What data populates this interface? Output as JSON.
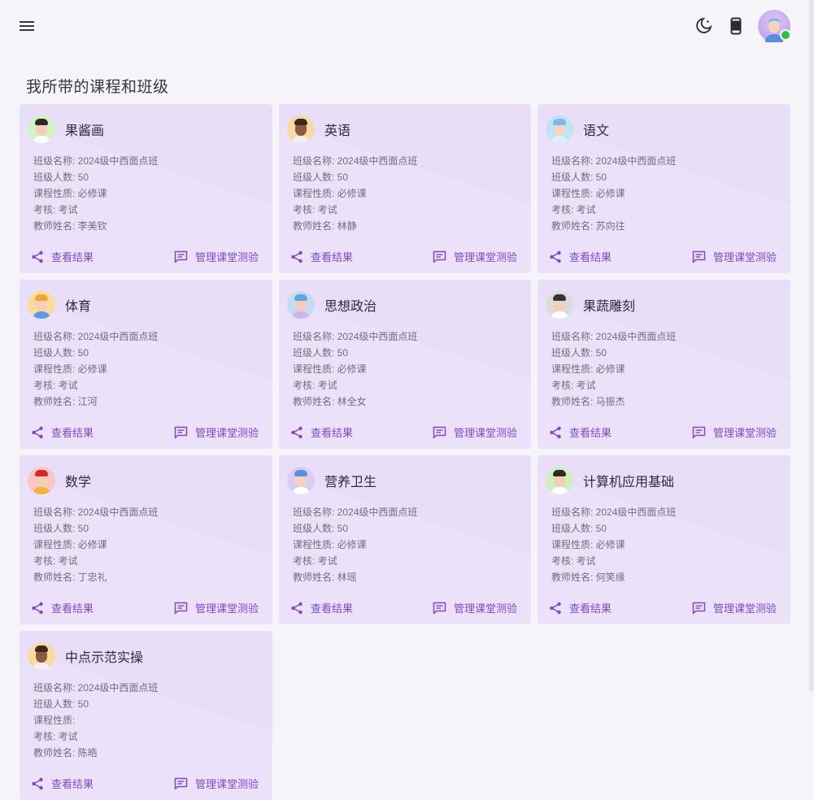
{
  "page": {
    "title": "我所带的课程和班级"
  },
  "labels": {
    "class_name": "班级名称: ",
    "student_count": "班级人数: ",
    "course_type": "课程性质: ",
    "assessment": "考核: ",
    "teacher": "教师姓名: ",
    "view_results": "查看结果",
    "manage_quiz": "管理课堂测验"
  },
  "courses": [
    {
      "title": "果酱画",
      "class_name": "2024级中西面点班",
      "student_count": "50",
      "course_type": "必修课",
      "assessment": "考试",
      "teacher": "李美钦",
      "avatar_bg": "#d3f2c4",
      "hair": "#2d2824",
      "skin": "#f4cdb7",
      "shirt": "#ffffff"
    },
    {
      "title": "英语",
      "class_name": "2024级中西面点班",
      "student_count": "50",
      "course_type": "必修课",
      "assessment": "考试",
      "teacher": "林静",
      "avatar_bg": "#f8d9a4",
      "hair": "#3a2b22",
      "skin": "#8b5a3c",
      "shirt": "#f0f0f0"
    },
    {
      "title": "语文",
      "class_name": "2024级中西面点班",
      "student_count": "50",
      "course_type": "必修课",
      "assessment": "考试",
      "teacher": "苏向往",
      "avatar_bg": "#bfe2f6",
      "hair": "#7fb6e8",
      "skin": "#f6d4c2",
      "shirt": "#dfeffa"
    },
    {
      "title": "体育",
      "class_name": "2024级中西面点班",
      "student_count": "50",
      "course_type": "必修课",
      "assessment": "考试",
      "teacher": "江河",
      "avatar_bg": "#f9dca0",
      "hair": "#f5a537",
      "skin": "#f7cfb2",
      "shirt": "#5f98e8"
    },
    {
      "title": "思想政治",
      "class_name": "2024级中西面点班",
      "student_count": "50",
      "course_type": "必修课",
      "assessment": "考试",
      "teacher": "林全女",
      "avatar_bg": "#c3dcf3",
      "hair": "#5ba7e3",
      "skin": "#f3cdbb",
      "shirt": "#cfb4ef"
    },
    {
      "title": "果蔬雕刻",
      "class_name": "2024级中西面点班",
      "student_count": "50",
      "course_type": "必修课",
      "assessment": "考试",
      "teacher": "马振杰",
      "avatar_bg": "#dcdcdc",
      "hair": "#3b3330",
      "skin": "#f3d0c0",
      "shirt": "#ffffff"
    },
    {
      "title": "数学",
      "class_name": "2024级中西面点班",
      "student_count": "50",
      "course_type": "必修课",
      "assessment": "考试",
      "teacher": "丁忠礼",
      "avatar_bg": "#f7c7c9",
      "hair": "#d8262c",
      "skin": "#f5cdb1",
      "shirt": "#f0b33c"
    },
    {
      "title": "营养卫生",
      "class_name": "2024级中西面点班",
      "student_count": "50",
      "course_type": "必修课",
      "assessment": "考试",
      "teacher": "林瑶",
      "avatar_bg": "#d9cdf3",
      "hair": "#5a8fe0",
      "skin": "#f5d2c4",
      "shirt": "#ffffff"
    },
    {
      "title": "计算机应用基础",
      "class_name": "2024级中西面点班",
      "student_count": "50",
      "course_type": "必修课",
      "assessment": "考试",
      "teacher": "何笑缘",
      "avatar_bg": "#cfeec1",
      "hair": "#2d2824",
      "skin": "#f4cdb7",
      "shirt": "#ffffff"
    },
    {
      "title": "中点示范实操",
      "class_name": "2024级中西面点班",
      "student_count": "50",
      "course_type": "",
      "assessment": "考试",
      "teacher": "陈皓",
      "avatar_bg": "#f8d9a4",
      "hair": "#3a2b22",
      "skin": "#8b5a3c",
      "shirt": "#f0f0f0"
    }
  ],
  "colors": {
    "accent": "#7d49c6",
    "card_bg": "#e8def8",
    "page_bg": "#f5f4f9",
    "online": "#2bc23d"
  },
  "icons": {
    "menu": "menu-icon",
    "theme": "dark-mode-icon",
    "device": "phone-icon",
    "share": "share-icon",
    "quiz": "chat-box-icon"
  }
}
